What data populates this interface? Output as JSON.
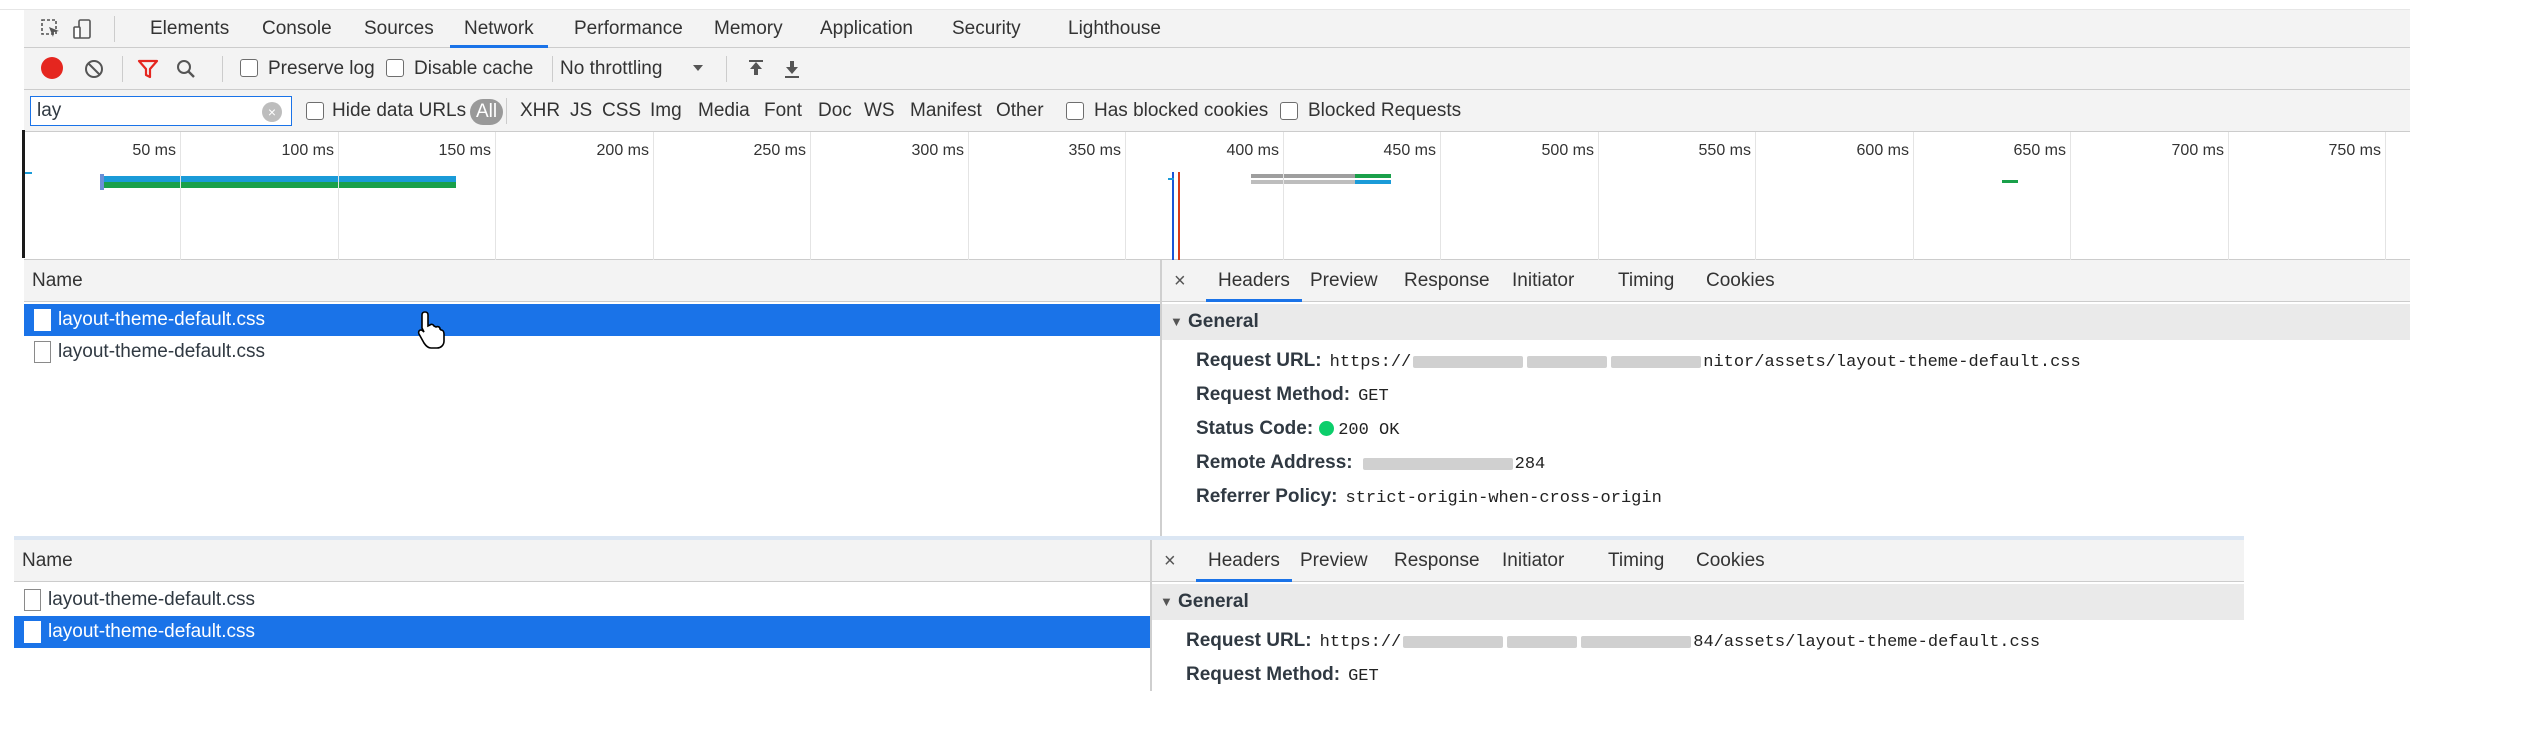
{
  "tabs": {
    "items": [
      "Elements",
      "Console",
      "Sources",
      "Network",
      "Performance",
      "Memory",
      "Application",
      "Security",
      "Lighthouse"
    ],
    "active": "Network"
  },
  "toolbar": {
    "preserve_log": "Preserve log",
    "disable_cache": "Disable cache",
    "throttling": "No throttling"
  },
  "filter": {
    "value": "lay",
    "hide_data_urls": "Hide data URLs",
    "all": "All",
    "types": [
      "XHR",
      "JS",
      "CSS",
      "Img",
      "Media",
      "Font",
      "Doc",
      "WS",
      "Manifest",
      "Other"
    ],
    "has_blocked_cookies": "Has blocked cookies",
    "blocked_requests": "Blocked Requests"
  },
  "timeline": {
    "ticks": [
      "50 ms",
      "100 ms",
      "150 ms",
      "200 ms",
      "250 ms",
      "300 ms",
      "350 ms",
      "400 ms",
      "450 ms",
      "500 ms",
      "550 ms",
      "600 ms",
      "650 ms",
      "700 ms",
      "750 ms"
    ]
  },
  "upper": {
    "name_header": "Name",
    "rows": [
      {
        "name": "layout-theme-default.css",
        "selected": true
      },
      {
        "name": "layout-theme-default.css",
        "selected": false
      }
    ],
    "detail_tabs": [
      "Headers",
      "Preview",
      "Response",
      "Initiator",
      "Timing",
      "Cookies"
    ],
    "active_detail_tab": "Headers",
    "close": "×",
    "section": "General",
    "request_url_label": "Request URL:",
    "request_url_prefix": "https://",
    "request_url_suffix": "nitor/assets/layout-theme-default.css",
    "request_method_label": "Request Method:",
    "request_method": "GET",
    "status_code_label": "Status Code:",
    "status_code": "200 OK",
    "remote_address_label": "Remote Address:",
    "remote_address_suffix": "284",
    "referrer_policy_label": "Referrer Policy:",
    "referrer_policy": "strict-origin-when-cross-origin"
  },
  "lower": {
    "name_header": "Name",
    "rows": [
      {
        "name": "layout-theme-default.css",
        "selected": false
      },
      {
        "name": "layout-theme-default.css",
        "selected": true
      }
    ],
    "detail_tabs": [
      "Headers",
      "Preview",
      "Response",
      "Initiator",
      "Timing",
      "Cookies"
    ],
    "active_detail_tab": "Headers",
    "close": "×",
    "section": "General",
    "request_url_label": "Request URL:",
    "request_url_prefix": "https://",
    "request_url_suffix": "84/assets/layout-theme-default.css",
    "request_method_label": "Request Method:",
    "request_method": "GET"
  },
  "colors": {
    "accent": "#1a73e8",
    "record": "#e5261f",
    "status_ok": "#0cce6b",
    "filter_funnel": "#e5261f"
  }
}
